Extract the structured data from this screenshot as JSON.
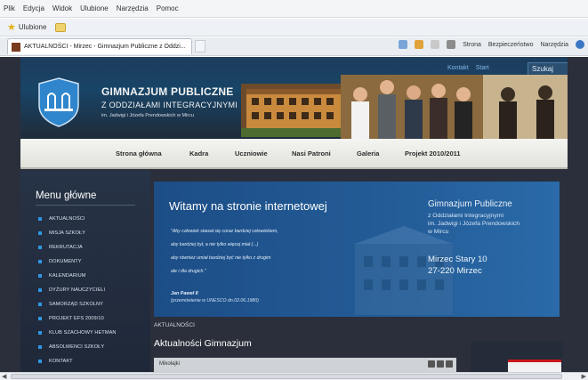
{
  "browser": {
    "menu": [
      "Plik",
      "Edycja",
      "Widok",
      "Ulubione",
      "Narzędzia",
      "Pomoc"
    ],
    "favorites_label": "Ulubione",
    "tab_title": "AKTUALNOŚCI - Mirzec - Gimnazjum Publiczne z Oddzi...",
    "commands": [
      "Strona",
      "Bezpieczeństwo",
      "Narzędzia"
    ]
  },
  "header": {
    "links": [
      "Kontakt",
      "Start"
    ],
    "search_placeholder": "Szukaj",
    "school_name_line1": "GIMNAZJUM PUBLICZNE",
    "school_name_line2": "Z ODDZIAŁAMI INTEGRACYJNYMI",
    "school_name_line3": "im. Jadwigi i Józefa Prendowskich w Mircu"
  },
  "nav": [
    "Strona główna",
    "Kadra",
    "Uczniowie",
    "Nasi Patroni",
    "Galeria",
    "Projekt 2010/2011"
  ],
  "sidebar": {
    "title": "Menu główne",
    "items": [
      "AKTUALNOŚCI",
      "MISJA SZKOŁY",
      "REKRUTACJA",
      "DOKUMENTY",
      "KALENDARIUM",
      "DYŻURY NAUCZYCIELI",
      "SAMORZĄD SZKOLNY",
      "PROJEKT EFS 2009/10",
      "KLUB SZACHOWY HETMAN",
      "ABSOLWENCI SZKOŁY",
      "KONTAKT"
    ]
  },
  "banner": {
    "welcome": "Witamy na stronie internetowej",
    "quote_lines": [
      "\"Aby człowiek stawał się coraz bardziej człowiekiem,",
      "aby bardziej był, a nie tylko więcej miał (...)",
      "aby również umiał bardziej być nie tylko z drugim",
      "ale i dla drugich.\""
    ],
    "author": "Jan Paweł II",
    "author_note": "(przemówienie w UNESCO dn.02.06.1980)",
    "school_title": "Gimnazjum Publiczne",
    "school_sub": [
      "z Oddziałami Integracyjnymi",
      "im. Jadwigi i Józefa Prendowskich",
      "w Mircu"
    ],
    "address": [
      "Mirzec Stary 10",
      "27-220 Mirzec"
    ]
  },
  "content": {
    "breadcrumb": "AKTUALNOŚCI",
    "heading": "Aktualności Gimnazjum",
    "news_title": "Mikołajki"
  },
  "colors": {
    "accent": "#2f97e0",
    "banner": "#235b96",
    "nav": "#e9e9e4",
    "page_bg": "#2a2f3b"
  }
}
